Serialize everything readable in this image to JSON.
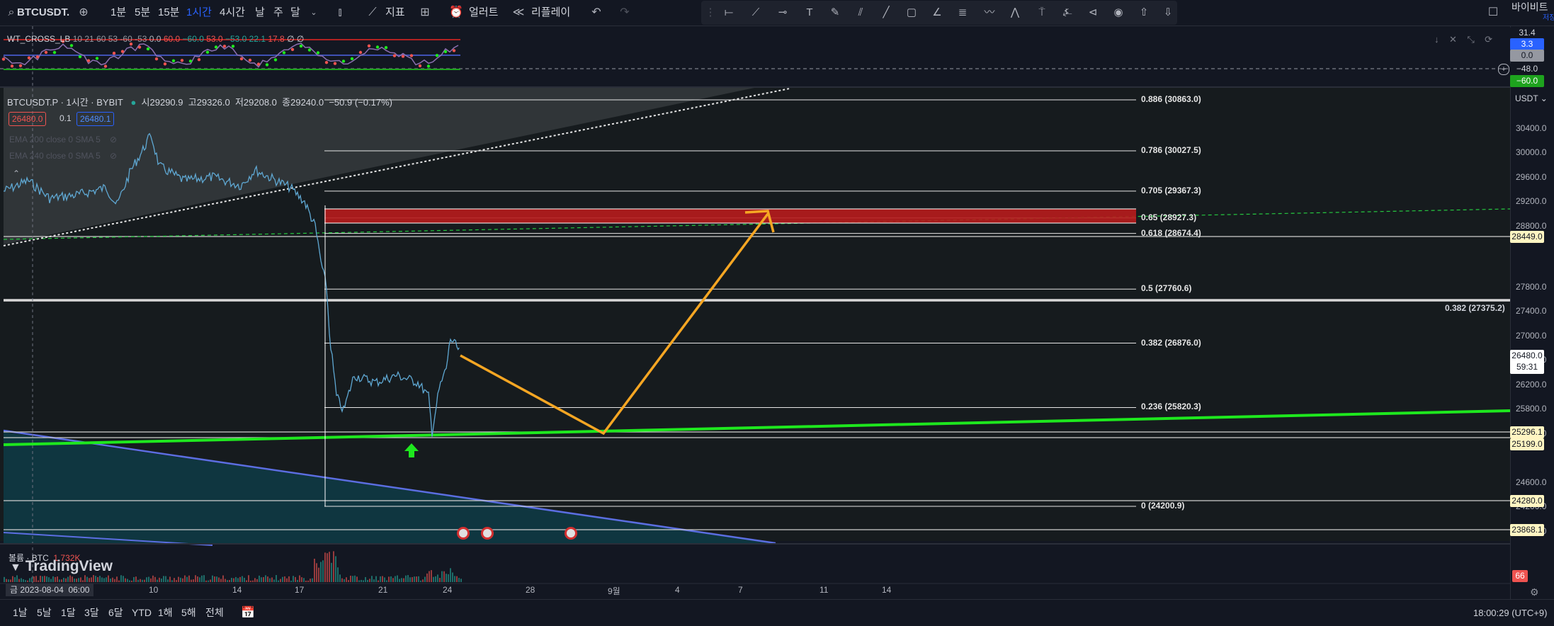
{
  "toolbar": {
    "symbol": "BTCUSDT.",
    "intervals": [
      "1분",
      "5분",
      "15분",
      "1시간",
      "4시간",
      "날",
      "주",
      "달"
    ],
    "active_interval": "1시간",
    "indicators_label": "지표",
    "alert_label": "얼러트",
    "replay_label": "리플레이",
    "exchange": "바이비트",
    "save_label": "저장"
  },
  "oscillator": {
    "name": "WT_CROSS_LB",
    "params": "10 21 60 53 -60 -53",
    "values": [
      "0.0",
      "60.0",
      "−60.0",
      "53.0",
      "−53.0",
      "22.1",
      "17.8",
      "∅",
      "∅"
    ],
    "axis": [
      "31.4",
      "3.3",
      "0.0",
      "−48.0",
      "−60.0"
    ]
  },
  "legend": {
    "title": "BTCUSDT.P · 1시간 · BYBIT",
    "open_label": "시",
    "open": "29290.9",
    "high_label": "고",
    "high": "29326.0",
    "low_label": "저",
    "low": "29208.0",
    "close_label": "종",
    "close": "29240.0",
    "change": "−50.9 (−0.17%)",
    "bid": "26480.0",
    "spread": "0.1",
    "ask": "26480.1",
    "ema200": "EMA 200 close 0 SMA 5",
    "ema240": "EMA 240 close 0 SMA 5"
  },
  "fib": [
    {
      "label": "0.886 (30863.0)",
      "price": 30863.0
    },
    {
      "label": "0.786 (30027.5)",
      "price": 30027.5
    },
    {
      "label": "0.705 (29367.3)",
      "price": 29367.3
    },
    {
      "label": "0.65 (28927.3)",
      "price": 28927.3
    },
    {
      "label": "0.618 (28674.4)",
      "price": 28674.4
    },
    {
      "label": "0.5 (27760.6)",
      "price": 27760.6
    },
    {
      "label": "0.382 (26876.0)",
      "price": 26876.0
    },
    {
      "label": "0.236 (25820.3)",
      "price": 25820.3
    },
    {
      "label": "0 (24200.9)",
      "price": 24200.9
    }
  ],
  "fib_far_label": "0.382 (27375.2)",
  "price_axis": {
    "currency": "USDT",
    "ticks": [
      "30400.0",
      "30000.0",
      "29600.0",
      "29200.0",
      "28800.0",
      "27800.0",
      "27400.0",
      "27000.0",
      "26600.0",
      "26200.0",
      "25800.0",
      "25400.0",
      "24600.0",
      "24200.0",
      "23800.0"
    ],
    "current_price": "26480.0",
    "countdown": "59:31",
    "level_boxes": [
      "28449.0",
      "25296.1",
      "25199.0",
      "24280.0",
      "23868.1"
    ]
  },
  "volume": {
    "label": "볼륨 · BTC",
    "value": "1.732K",
    "badge": "66"
  },
  "watermark": "TradingView",
  "time_axis": {
    "ticks": [
      "10",
      "14",
      "17",
      "21",
      "24",
      "28",
      "9월",
      "4",
      "7",
      "11",
      "14"
    ],
    "cursor_date": "금 2023-08-04",
    "cursor_time": "06:00"
  },
  "bottom": {
    "ranges": [
      "1날",
      "5날",
      "1달",
      "3달",
      "6달",
      "YTD",
      "1해",
      "5해",
      "전체"
    ],
    "clock": "18:00:29 (UTC+9)"
  },
  "colors": {
    "bg": "#131722",
    "accent": "#2962ff",
    "up": "#26a69a",
    "down": "#ef5350",
    "green_line": "#1ee81e",
    "orange": "#f5a623"
  }
}
